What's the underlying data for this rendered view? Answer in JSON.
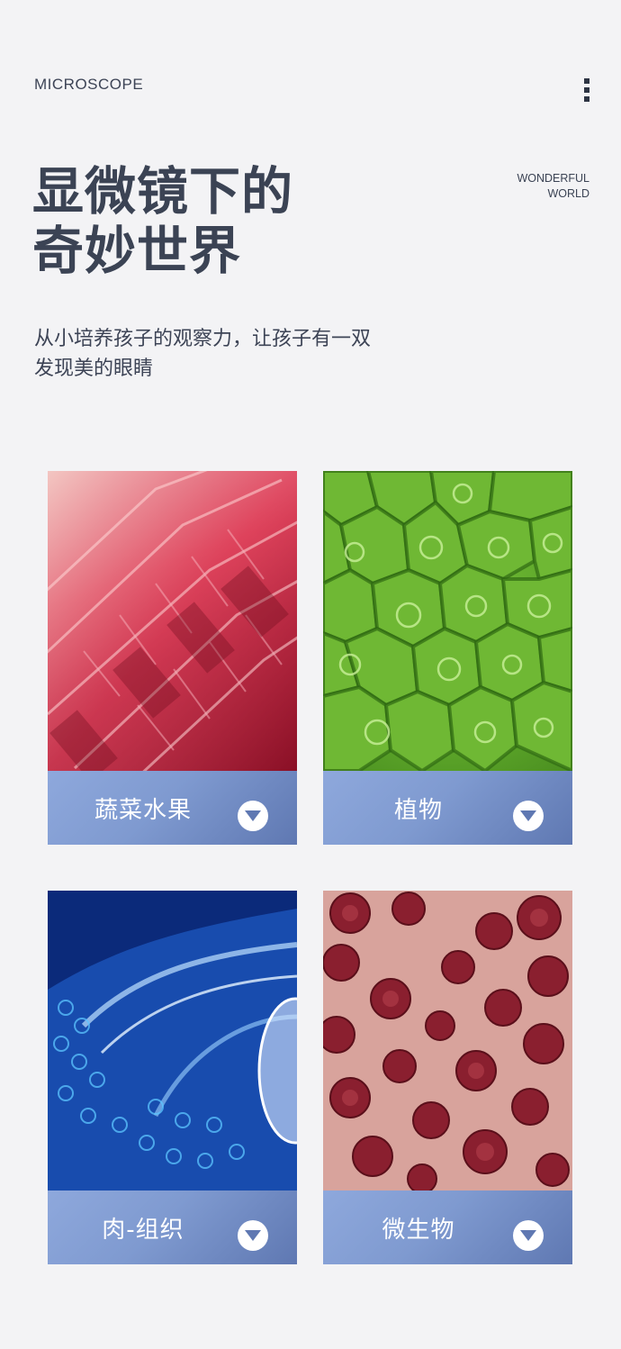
{
  "header": {
    "brand": "MICROSCOPE",
    "menu_icon": "more-vertical-icon",
    "title_line1": "显微镜下的",
    "title_line2": "奇妙世界",
    "tagline_line1": "WONDERFUL",
    "tagline_line2": "WORLD",
    "subtitle_line1": "从小培养孩子的观察力，让孩子有一双",
    "subtitle_line2": "发现美的眼睛"
  },
  "cards": [
    {
      "label": "蔬菜水果",
      "icon": "chevron-down-circle-icon"
    },
    {
      "label": "植物",
      "icon": "chevron-down-circle-icon"
    },
    {
      "label": "肉-组织",
      "icon": "chevron-down-circle-icon"
    },
    {
      "label": "微生物",
      "icon": "chevron-down-circle-icon"
    }
  ],
  "colors": {
    "background": "#f3f3f5",
    "text": "#3b4354",
    "bar_light": "#8ea8dc",
    "bar_dark": "#5f78b2",
    "arrow": "#5f78b2"
  }
}
